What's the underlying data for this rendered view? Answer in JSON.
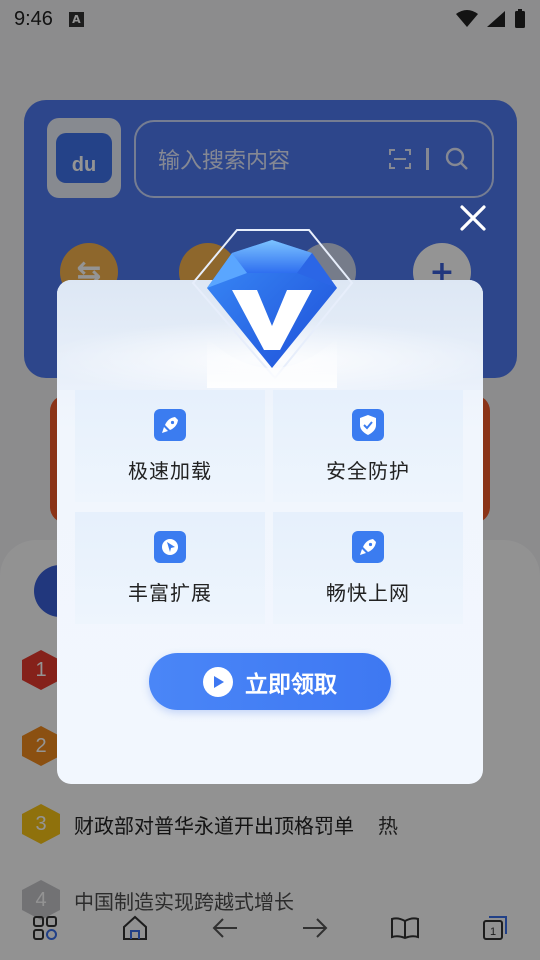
{
  "status_bar": {
    "time": "9:46",
    "notif_letter": "A"
  },
  "background": {
    "baidu_logo_text": "du",
    "search_placeholder": "输入搜索内容",
    "hot_list": [
      {
        "rank": "1",
        "title": ""
      },
      {
        "rank": "2",
        "title": ""
      },
      {
        "rank": "3",
        "title": "财政部对普华永道开出顶格罚单",
        "tag": "热"
      },
      {
        "rank": "4",
        "title": "中国制造实现跨越式增长"
      }
    ]
  },
  "dialog": {
    "features": [
      {
        "label": "极速加载",
        "icon": "rocket-icon"
      },
      {
        "label": "安全防护",
        "icon": "shield-icon"
      },
      {
        "label": "丰富扩展",
        "icon": "pin-icon"
      },
      {
        "label": "畅快上网",
        "icon": "rocket-icon"
      }
    ],
    "claim_button": "立即领取",
    "accent_color": "#3e78f2"
  },
  "bottom_nav": {
    "tab_count": "1"
  }
}
